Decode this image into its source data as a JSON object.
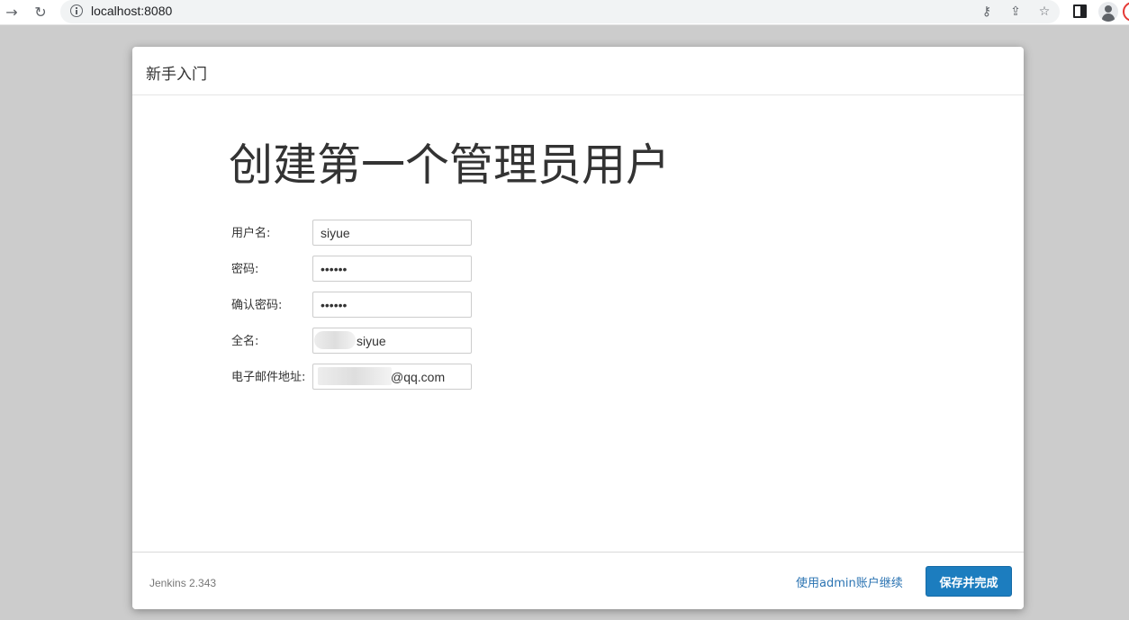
{
  "browser": {
    "url": "localhost:8080",
    "icons": {
      "back": "arrow-right-icon",
      "reload": "reload-icon",
      "info": "info-icon",
      "key": "key-icon",
      "share": "share-icon",
      "bookmark": "star-icon",
      "side_panel": "side-panel-icon",
      "profile": "avatar-icon"
    }
  },
  "dialog": {
    "title": "新手入门",
    "heading": "创建第一个管理员用户",
    "fields": [
      {
        "label": "用户名:",
        "value": "siyue"
      },
      {
        "label": "密码:",
        "value": "••••••"
      },
      {
        "label": "确认密码:",
        "value": "••••••"
      },
      {
        "label": "全名:",
        "value": "siyue"
      },
      {
        "label": "电子邮件地址:",
        "value": "@qq.com"
      }
    ]
  },
  "footer": {
    "version": "Jenkins 2.343",
    "continue_as_admin": "使用admin账户继续",
    "save_button": "保存并完成"
  },
  "colors": {
    "primary_button": "#1c7dbf",
    "link": "#2a73b2",
    "backdrop": "#cccccc"
  }
}
